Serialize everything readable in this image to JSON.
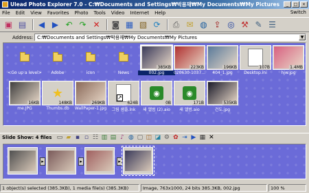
{
  "window": {
    "title": "Ulead Photo Explorer 7.0 - C:₩Documents and Settings₩박용재₩My Documents₩My Pictures"
  },
  "menu": {
    "items": [
      "File",
      "Edit",
      "View",
      "Favorites",
      "Photo",
      "Tools",
      "Video",
      "Internet",
      "Help"
    ],
    "right": "Switch"
  },
  "address": {
    "label": "Address:",
    "value": "C:₩Documents and Settings₩박용재₩My Documents₩My Pictures"
  },
  "files": [
    {
      "name": "<Go up a level>",
      "size": "",
      "type": "folder",
      "selected": false
    },
    {
      "name": "Adobe",
      "size": "",
      "type": "folder",
      "selected": false
    },
    {
      "name": "icon",
      "size": "",
      "type": "folder",
      "selected": false
    },
    {
      "name": "News",
      "size": "",
      "type": "folder",
      "selected": false
    },
    {
      "name": "002.jpg",
      "size": "385KB",
      "type": "photo",
      "selected": true,
      "color": "#3a3a5a"
    },
    {
      "name": "020630-1037...",
      "size": "223KB",
      "type": "photo",
      "selected": false,
      "color": "#b03030"
    },
    {
      "name": "404_1.jpg",
      "size": "196KB",
      "type": "photo",
      "selected": false,
      "color": "#5a7a9a"
    },
    {
      "name": "Desktop.ini",
      "size": "107B",
      "type": "doc",
      "selected": false
    },
    {
      "name": "hjw.jpg",
      "size": "1.4MB",
      "type": "photo",
      "selected": false,
      "color": "#d86080"
    },
    {
      "name": "me.JPG",
      "size": "16KB",
      "type": "photo",
      "selected": false,
      "color": "#404040"
    },
    {
      "name": "Thumbs.db",
      "size": "148KB",
      "type": "star",
      "selected": false
    },
    {
      "name": "WallPaper-1.jpg",
      "size": "269KB",
      "type": "photo",
      "selected": false,
      "color": "#8a6a5a"
    },
    {
      "name": "그림 샘플.lnk",
      "size": "624B",
      "type": "shortcut",
      "selected": false
    },
    {
      "name": "새 앨범 (2).aio",
      "size": "0B",
      "type": "eye",
      "selected": false
    },
    {
      "name": "새 앨범.aio",
      "size": "171B",
      "type": "eye",
      "selected": false
    },
    {
      "name": "건도.jpg",
      "size": "535KB",
      "type": "photo",
      "selected": false,
      "color": "#1a1a2a"
    }
  ],
  "slideshow": {
    "label": "Slide Show: 4 files",
    "frames": [
      {
        "color": "#505050"
      },
      {
        "color": "#7a5a5a"
      },
      {
        "color": "#a06060"
      },
      {
        "color": "#3a3a5a"
      }
    ]
  },
  "status": {
    "selection": "1 object(s) selected (385.3KB), 1 media file(s) (385.3KB)",
    "image_info": "Image, 763x1000, 24 bits 385.3KB, 002.jpg",
    "zoom": "100 %"
  }
}
